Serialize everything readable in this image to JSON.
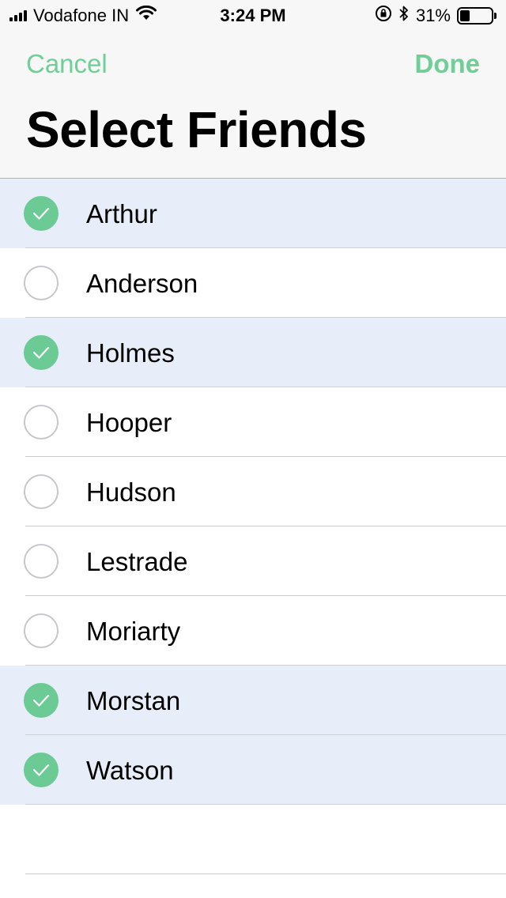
{
  "status_bar": {
    "carrier": "Vodafone IN",
    "time": "3:24 PM",
    "battery_percent": "31%",
    "battery_level": 0.31,
    "icons": [
      "signal-icon",
      "wifi-icon",
      "orientation-lock-icon",
      "bluetooth-icon",
      "battery-icon"
    ]
  },
  "nav": {
    "cancel_label": "Cancel",
    "done_label": "Done",
    "title": "Select Friends"
  },
  "colors": {
    "accent": "#6fcf97",
    "selected_row_bg": "#e8eef9",
    "check_fill": "#6cca95"
  },
  "friends": [
    {
      "name": "Arthur",
      "selected": true
    },
    {
      "name": "Anderson",
      "selected": false
    },
    {
      "name": "Holmes",
      "selected": true
    },
    {
      "name": "Hooper",
      "selected": false
    },
    {
      "name": "Hudson",
      "selected": false
    },
    {
      "name": "Lestrade",
      "selected": false
    },
    {
      "name": "Moriarty",
      "selected": false
    },
    {
      "name": "Morstan",
      "selected": true
    },
    {
      "name": "Watson",
      "selected": true
    }
  ]
}
